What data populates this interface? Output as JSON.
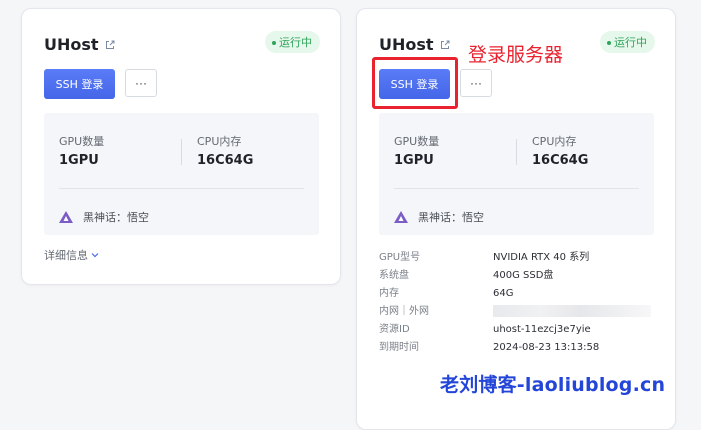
{
  "cards": [
    {
      "title": "UHost",
      "status": "运行中",
      "ssh_label": "SSH 登录",
      "more_label": "···",
      "gpu_label": "GPU数量",
      "gpu_value": "1GPU",
      "cpu_label": "CPU内存",
      "cpu_value": "16C64G",
      "game": "黑神话：悟空",
      "details_label": "详细信息"
    },
    {
      "title": "UHost",
      "status": "运行中",
      "ssh_label": "SSH 登录",
      "more_label": "···",
      "gpu_label": "GPU数量",
      "gpu_value": "1GPU",
      "cpu_label": "CPU内存",
      "cpu_value": "16C64G",
      "game": "黑神话：悟空",
      "info": [
        {
          "label": "GPU型号",
          "value": "NVIDIA RTX 40 系列"
        },
        {
          "label": "系统盘",
          "value": "400G SSD盘"
        },
        {
          "label": "内存",
          "value": "64G"
        },
        {
          "label": "内网｜外网",
          "value": ""
        },
        {
          "label": "资源ID",
          "value": "uhost-11ezcj3e7yie"
        },
        {
          "label": "到期时间",
          "value": "2024-08-23 13:13:58"
        }
      ]
    }
  ],
  "annotation": {
    "callout": "登录服务器",
    "watermark": "老刘博客-laoliublog.cn"
  },
  "colors": {
    "accent": "#4a6cf0",
    "status": "#2fa35a",
    "highlight": "#e8222e",
    "watermark": "#2446d8"
  },
  "icons": {
    "edit": "external-edit-icon",
    "game": "game-logo-icon",
    "details": "chevron-down-icon"
  }
}
